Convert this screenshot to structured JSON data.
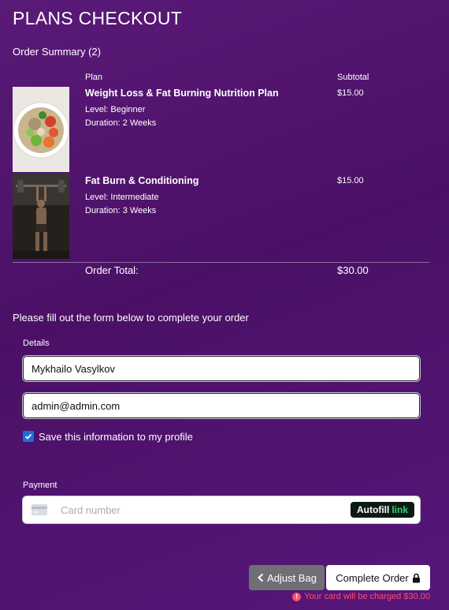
{
  "page": {
    "title": "PLANS CHECKOUT"
  },
  "summary": {
    "heading": "Order Summary (2)",
    "col_plan": "Plan",
    "col_subtotal": "Subtotal",
    "items": [
      {
        "name": "Weight Loss & Fat Burning Nutrition Plan",
        "level": "Level: Beginner",
        "duration": "Duration: 2 Weeks",
        "price": "$15.00",
        "image_icon": "salad-bowl-image"
      },
      {
        "name": "Fat Burn & Conditioning",
        "level": "Level: Intermediate",
        "duration": "Duration: 3 Weeks",
        "price": "$15.00",
        "image_icon": "weightlifter-image"
      }
    ],
    "total_label": "Order Total:",
    "total_value": "$30.00"
  },
  "form": {
    "instructions": "Please fill out the form below to complete your order",
    "details_label": "Details",
    "name_value": "Mykhailo Vasylkov",
    "email_value": "admin@admin.com",
    "save_label": "Save this information to my profile",
    "save_checked": true,
    "payment_label": "Payment",
    "card_placeholder": "Card number",
    "autofill_word": "Autofill",
    "link_word": "link"
  },
  "actions": {
    "adjust_label": "Adjust Bag",
    "complete_label": "Complete Order",
    "charge_note": "Your card will be charged $30.00"
  },
  "colors": {
    "background": "#4b1066",
    "accent_checkbox": "#1e6fd9",
    "warning": "#ff4d6d",
    "link_green": "#34d27a"
  }
}
